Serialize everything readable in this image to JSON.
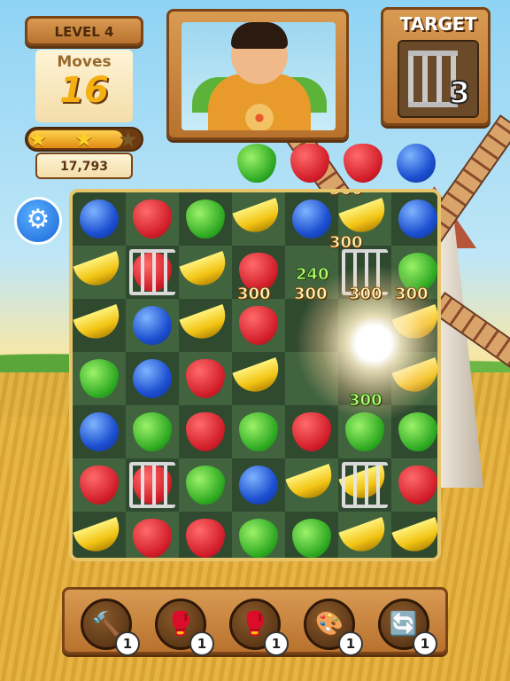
{
  "hud": {
    "level_label": "LEVEL 4",
    "moves_label": "Moves",
    "moves_value": "16",
    "score": "17,793",
    "stars": {
      "earned": 2,
      "total": 3,
      "progress": 0.85
    },
    "target_label": "TARGET",
    "target_count": "3",
    "target_icon": "cage-icon"
  },
  "incoming_fruits": [
    "pear",
    "strawberry",
    "strawberry",
    "blueberry"
  ],
  "board": {
    "cols": 7,
    "rows": 7,
    "cells": [
      [
        "blueberry",
        "strawberry",
        "pear",
        "banana",
        "blueberry",
        "banana",
        "blueberry"
      ],
      [
        "banana",
        "strawberry",
        "banana",
        "strawberry",
        "",
        "",
        "pear"
      ],
      [
        "banana",
        "blueberry",
        "banana",
        "strawberry",
        "",
        "",
        "banana"
      ],
      [
        "pear",
        "blueberry",
        "strawberry",
        "banana",
        "",
        "",
        "banana"
      ],
      [
        "blueberry",
        "pear",
        "strawberry",
        "pear",
        "strawberry",
        "pear",
        "pear"
      ],
      [
        "strawberry",
        "strawberry",
        "pear",
        "blueberry",
        "banana",
        "banana",
        "strawberry"
      ],
      [
        "banana",
        "strawberry",
        "strawberry",
        "pear",
        "pear",
        "banana",
        "banana"
      ]
    ],
    "caged": [
      [
        1,
        1
      ],
      [
        5,
        1
      ],
      [
        5,
        5
      ],
      [
        1,
        5
      ]
    ],
    "score_pops": [
      {
        "text": "300",
        "color": "yellow"
      },
      {
        "text": "300",
        "color": "yellow"
      },
      {
        "text": "240",
        "color": "green"
      },
      {
        "text": "300",
        "color": "yellow"
      },
      {
        "text": "300",
        "color": "yellow"
      },
      {
        "text": "300",
        "color": "yellow"
      },
      {
        "text": "300",
        "color": "yellow"
      },
      {
        "text": "300",
        "color": "green"
      }
    ]
  },
  "boosters": [
    {
      "name": "hammer",
      "icon": "hammer-icon",
      "glyph": "🔨",
      "count": "1"
    },
    {
      "name": "glove",
      "icon": "boxing-glove-icon",
      "glyph": "🥊",
      "count": "1"
    },
    {
      "name": "glove-double",
      "icon": "boxing-gloves-icon",
      "glyph": "🥊",
      "count": "1"
    },
    {
      "name": "color-wheel",
      "icon": "color-wheel-icon",
      "glyph": "🎨",
      "count": "1"
    },
    {
      "name": "swap",
      "icon": "swap-icon",
      "glyph": "🔄",
      "count": "1"
    }
  ],
  "colors": {
    "accent": "#1a66d6",
    "wood": "#b8722e",
    "star": "#ffd028"
  }
}
